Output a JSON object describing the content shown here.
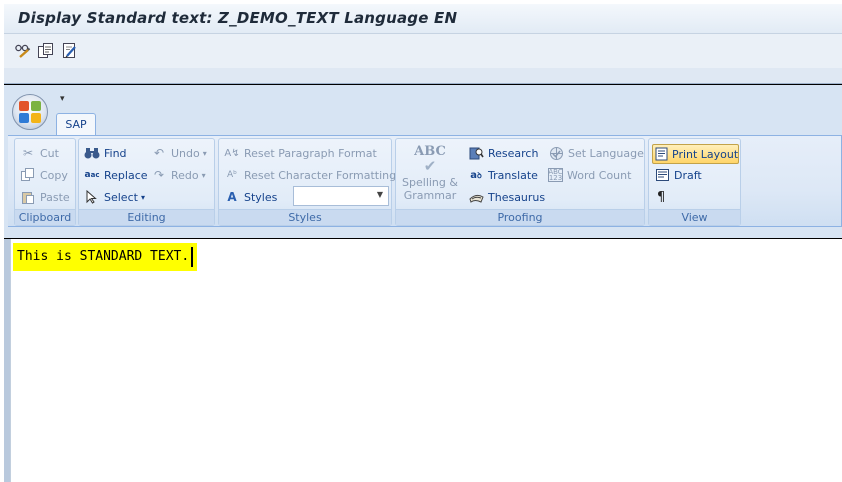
{
  "sap": {
    "title": "Display Standard text: Z_DEMO_TEXT Language EN",
    "toolbar_icons": [
      "glasses-icon",
      "object-copy-icon",
      "edit-pencil-icon"
    ]
  },
  "word": {
    "tab_label": "SAP",
    "groups": {
      "clipboard": {
        "label": "Clipboard",
        "cut": "Cut",
        "copy": "Copy",
        "paste": "Paste"
      },
      "editing": {
        "label": "Editing",
        "find": "Find",
        "replace": "Replace",
        "select": "Select",
        "undo": "Undo",
        "redo": "Redo"
      },
      "styles": {
        "label": "Styles",
        "reset_paragraph": "Reset Paragraph Format",
        "reset_character": "Reset Character Formatting",
        "styles": "Styles",
        "combo_value": ""
      },
      "proofing": {
        "label": "Proofing",
        "spelling": "Spelling &",
        "grammar": "Grammar",
        "spelling_glyph": "ABC",
        "research": "Research",
        "set_language": "Set Language",
        "translate": "Translate",
        "word_count": "Word Count",
        "thesaurus": "Thesaurus"
      },
      "view": {
        "label": "View",
        "print_layout": "Print Layout",
        "draft": "Draft",
        "pilcrow": "¶"
      }
    }
  },
  "document": {
    "text": "This is STANDARD TEXT.",
    "highlight_color": "#ffff00"
  }
}
